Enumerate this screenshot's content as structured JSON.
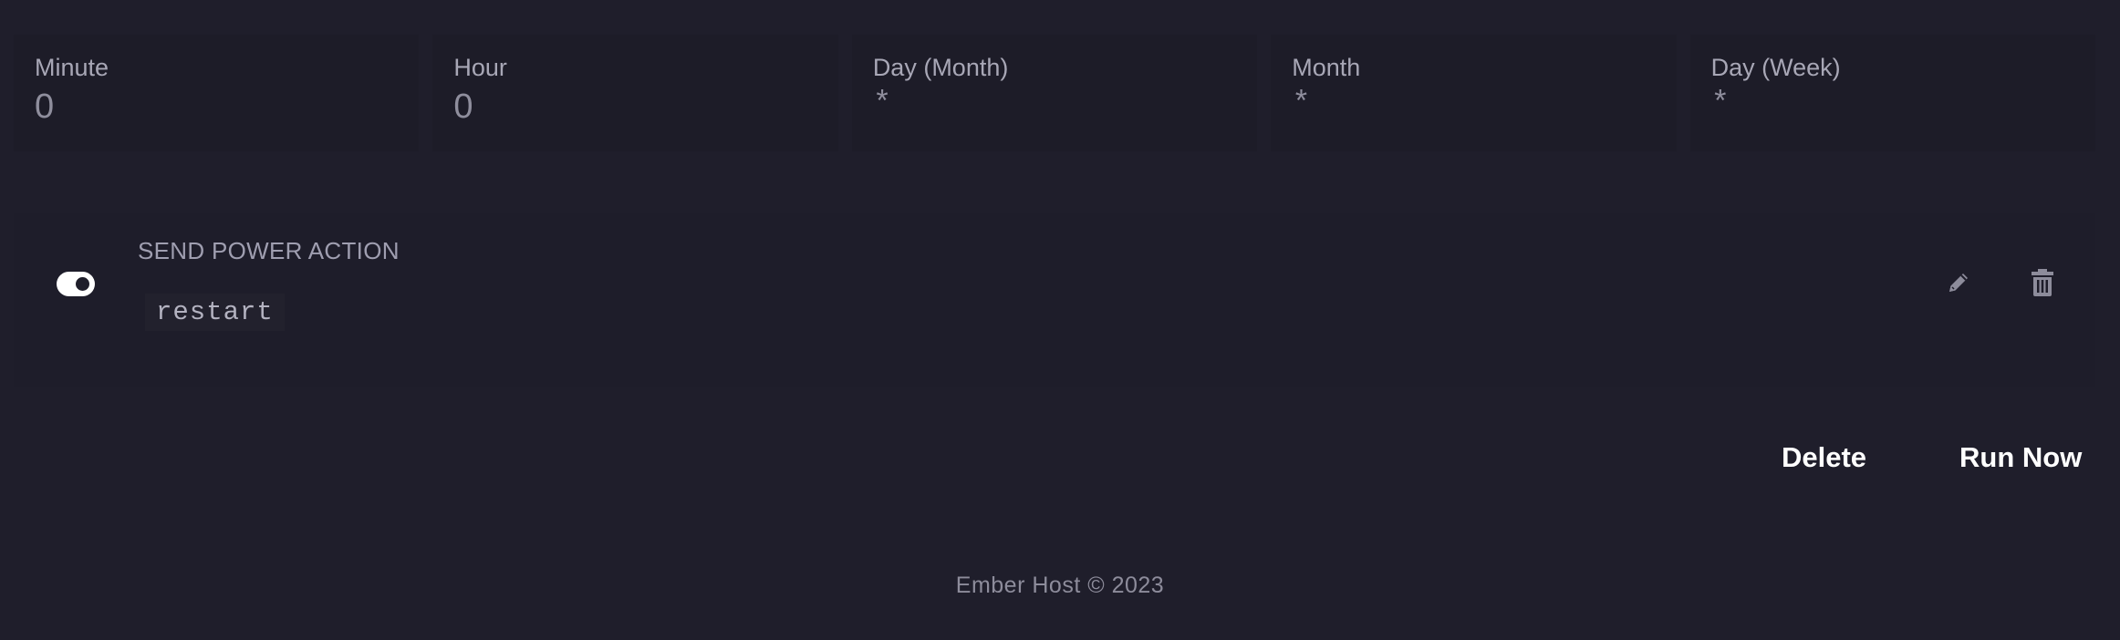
{
  "schedule": {
    "minute": {
      "label": "Minute",
      "value": "0"
    },
    "hour": {
      "label": "Hour",
      "value": "0"
    },
    "day_of_month": {
      "label": "Day (Month)",
      "value": "*"
    },
    "month": {
      "label": "Month",
      "value": "*"
    },
    "day_of_week": {
      "label": "Day (Week)",
      "value": "*"
    }
  },
  "task": {
    "title": "SEND POWER ACTION",
    "payload": "restart",
    "enabled": true
  },
  "actions": {
    "delete_label": "Delete",
    "run_now_label": "Run Now"
  },
  "footer": {
    "text": "Ember Host © 2023"
  },
  "icons": {
    "edit": "pencil-icon",
    "delete": "trash-icon"
  },
  "colors": {
    "background": "#1f1e2b",
    "text_primary": "#ffffff",
    "text_muted": "#8f8e9d"
  }
}
